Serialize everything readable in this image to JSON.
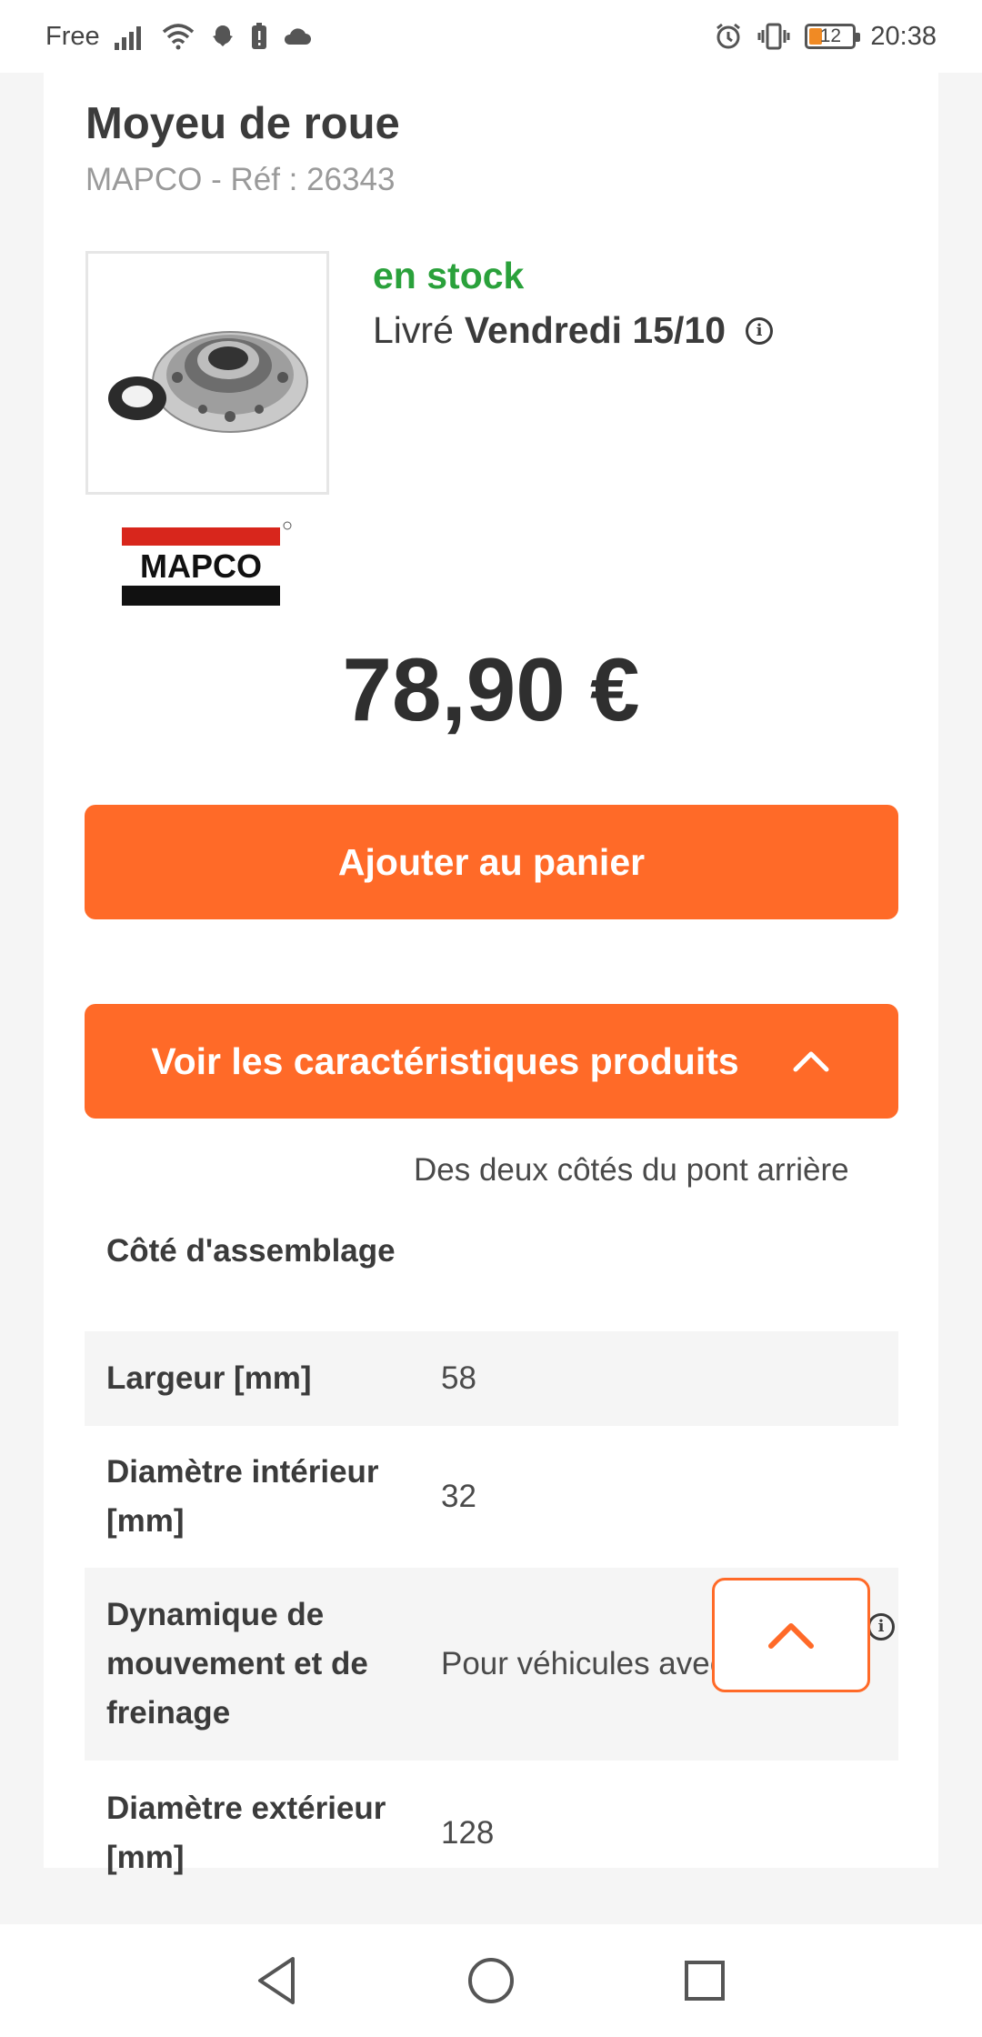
{
  "status_bar": {
    "carrier": "Free",
    "time": "20:38",
    "battery_level": "12"
  },
  "product": {
    "title": "Moyeu de roue",
    "subtitle": "MAPCO - Réf : 26343",
    "image_icon": "wheel-hub-image",
    "brand_logo_text": "MAPCO",
    "stock": "en stock",
    "delivery_prefix": "Livré",
    "delivery_date": "Vendredi 15/10",
    "price": "78,90 €"
  },
  "buttons": {
    "add_to_cart": "Ajouter au panier",
    "view_specs": "Voir les caractéristiques produits"
  },
  "specs": [
    {
      "label": "Côté d'assemblage",
      "value": "Des deux côtés du pont arrière"
    },
    {
      "label": "Largeur [mm]",
      "value": "58"
    },
    {
      "label": "Diamètre intérieur [mm]",
      "value": "32"
    },
    {
      "label": "Dynamique de mouvement et de freinage",
      "value": "Pour véhicules avec ABS"
    },
    {
      "label": "Diamètre extérieur [mm]",
      "value": "128"
    }
  ],
  "colors": {
    "accent": "#ff6a28",
    "stock_green": "#2aa13b",
    "text": "#3b3b3b"
  }
}
